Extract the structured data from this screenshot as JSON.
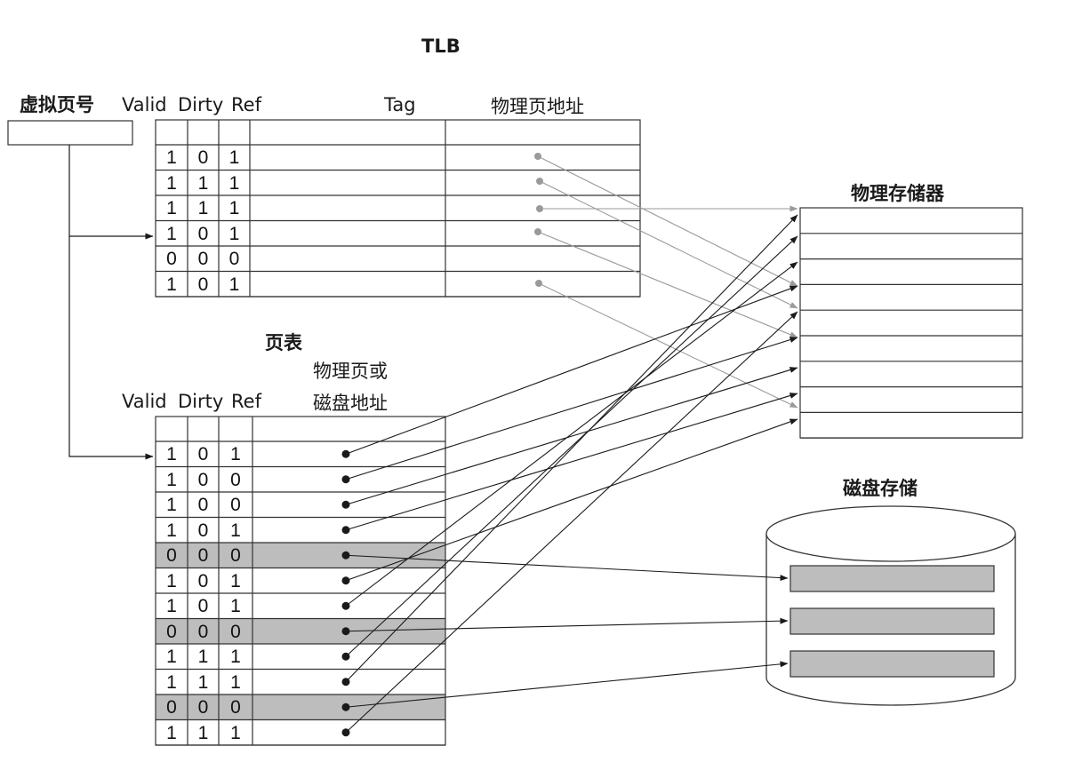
{
  "tlb": {
    "title": "TLB",
    "virtual_page_label": "虚拟页号",
    "columns": [
      "Valid",
      "Dirty",
      "Ref",
      "Tag",
      "物理页地址"
    ],
    "rows": [
      [
        "1",
        "0",
        "1"
      ],
      [
        "1",
        "1",
        "1"
      ],
      [
        "1",
        "1",
        "1"
      ],
      [
        "1",
        "0",
        "1"
      ],
      [
        "0",
        "0",
        "0"
      ],
      [
        "1",
        "0",
        "1"
      ]
    ]
  },
  "page_table": {
    "title": "页表",
    "columns": [
      "Valid",
      "Dirty",
      "Ref"
    ],
    "address_header": [
      "物理页或",
      "磁盘地址"
    ],
    "rows": [
      [
        "1",
        "0",
        "1"
      ],
      [
        "1",
        "0",
        "0"
      ],
      [
        "1",
        "0",
        "0"
      ],
      [
        "1",
        "0",
        "1"
      ],
      [
        "0",
        "0",
        "0"
      ],
      [
        "1",
        "0",
        "1"
      ],
      [
        "1",
        "0",
        "1"
      ],
      [
        "0",
        "0",
        "0"
      ],
      [
        "1",
        "1",
        "1"
      ],
      [
        "1",
        "1",
        "1"
      ],
      [
        "0",
        "0",
        "0"
      ],
      [
        "1",
        "1",
        "1"
      ]
    ]
  },
  "physical_memory": {
    "title": "物理存储器",
    "frames": 9
  },
  "disk": {
    "title": "磁盘存储",
    "blocks": 3
  },
  "colors": {
    "line": "#1a1a1a",
    "tlb_arrow": "#9a9a9a",
    "shade": "#bdbdbd",
    "border": "#333333"
  }
}
